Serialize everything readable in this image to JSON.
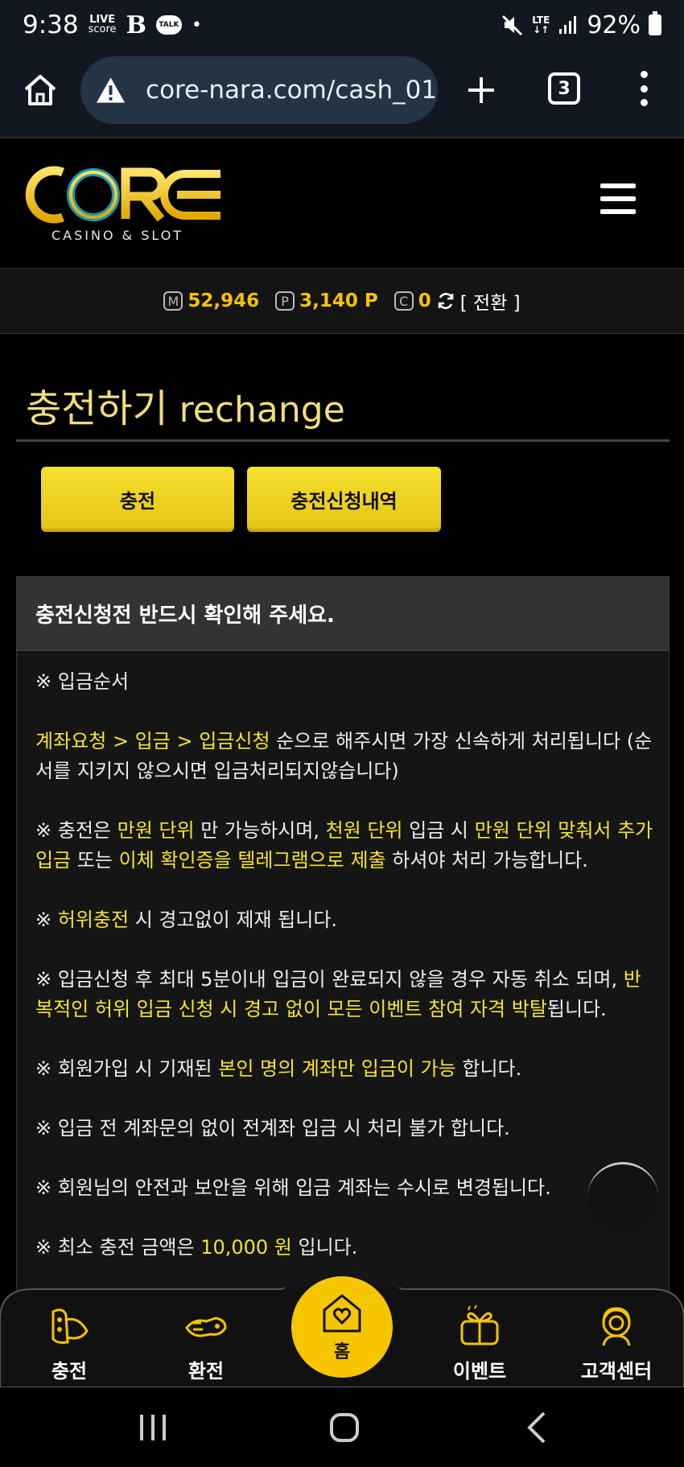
{
  "status_bar": {
    "time": "9:38",
    "live_score_line1": "LIVE",
    "live_score_line2": "score",
    "b_icon": "B",
    "talk_icon": "TALK",
    "dot": "•",
    "lte_line1": "LTE",
    "lte_line2": "↓↑",
    "battery": "92%"
  },
  "browser": {
    "url": "core-nara.com/cash_01.",
    "tab_count": "3"
  },
  "header": {
    "logo_text": "CORE",
    "logo_sub": "CASINO & SLOT"
  },
  "balance": {
    "money_badge": "M",
    "money_value": "52,946",
    "point_badge": "P",
    "point_value": "3,140 P",
    "coin_badge": "C",
    "coin_value": "0",
    "convert_label": "[ 전환 ]"
  },
  "page": {
    "title_ko": "충전하기",
    "title_en": "rechange"
  },
  "tabs": [
    {
      "label": "충전"
    },
    {
      "label": "충전신청내역"
    }
  ],
  "notice": {
    "heading": "충전신청전 반드시 확인해 주세요.",
    "p1": "※ 입금순서",
    "p2_hl": "계좌요청 > 입금 > 입금신청",
    "p2_text": " 순으로 해주시면 가장 신속하게 처리됩니다 (순서를 지키지 않으시면 입금처리되지않습니다)",
    "p3_a": "※ 충전은 ",
    "p3_b": "만원 단위",
    "p3_c": " 만 가능하시며, ",
    "p3_d": "천원 단위",
    "p3_e": " 입금 시 ",
    "p3_f": "만원 단위 맞춰서 추가입금",
    "p3_g": " 또는 ",
    "p3_h": "이체 확인증을 텔레그램으로 제출",
    "p3_i": " 하셔야 처리 가능합니다.",
    "p4_a": "※ ",
    "p4_b": "허위충전",
    "p4_c": " 시 경고없이 제재 됩니다.",
    "p5_a": "※ 입금신청 후 최대 5분이내 입금이 완료되지 않을 경우 자동 취소 되며, ",
    "p5_b": "반복적인 허위 입금 신청 시 경고 없이 모든 이벤트 참여 자격 박탈",
    "p5_c": "됩니다.",
    "p6_a": "※ 회원가입 시 기재된 ",
    "p6_b": "본인 명의 계좌만 입금이 가능",
    "p6_c": " 합니다.",
    "p7": "※ 입금 전 계좌문의 없이 전계좌 입금 시 처리 불가 합니다.",
    "p8": "※ 회원님의 안전과 보안을 위해 입금 계좌는 수시로 변경됩니다.",
    "p9_a": "※ 최소 충전 금액은 ",
    "p9_b": "10,000 원",
    "p9_c": " 입니다."
  },
  "bottom_nav": {
    "charge": "충전",
    "exchange": "환전",
    "home": "홈",
    "event": "이벤트",
    "support": "고객센터"
  },
  "colors": {
    "accent": "#f5c300",
    "highlight": "#f5e42e",
    "title": "#f1dc7c",
    "button": "#ecd01d"
  }
}
